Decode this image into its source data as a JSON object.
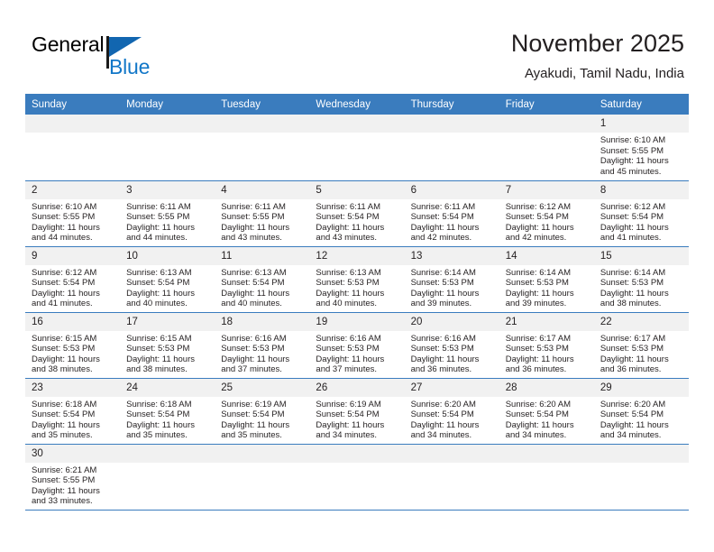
{
  "brand": {
    "name_part1": "General",
    "name_part2": "Blue",
    "flag_icon": "brand-flag-icon",
    "accent_color": "#1277c8"
  },
  "header": {
    "title": "November 2025",
    "subtitle": "Ayakudi, Tamil Nadu, India"
  },
  "colors": {
    "header_row_bg": "#3a7cbe",
    "header_row_text": "#ffffff",
    "daynum_bg": "#f1f1f1",
    "cell_border": "#3a7cbe",
    "text": "#231f20"
  },
  "weekday_headers": [
    "Sunday",
    "Monday",
    "Tuesday",
    "Wednesday",
    "Thursday",
    "Friday",
    "Saturday"
  ],
  "weeks": [
    [
      {
        "blank": true
      },
      {
        "blank": true
      },
      {
        "blank": true
      },
      {
        "blank": true
      },
      {
        "blank": true
      },
      {
        "blank": true
      },
      {
        "day": "1",
        "sunrise": "Sunrise: 6:10 AM",
        "sunset": "Sunset: 5:55 PM",
        "daylight1": "Daylight: 11 hours",
        "daylight2": "and 45 minutes."
      }
    ],
    [
      {
        "day": "2",
        "sunrise": "Sunrise: 6:10 AM",
        "sunset": "Sunset: 5:55 PM",
        "daylight1": "Daylight: 11 hours",
        "daylight2": "and 44 minutes."
      },
      {
        "day": "3",
        "sunrise": "Sunrise: 6:11 AM",
        "sunset": "Sunset: 5:55 PM",
        "daylight1": "Daylight: 11 hours",
        "daylight2": "and 44 minutes."
      },
      {
        "day": "4",
        "sunrise": "Sunrise: 6:11 AM",
        "sunset": "Sunset: 5:55 PM",
        "daylight1": "Daylight: 11 hours",
        "daylight2": "and 43 minutes."
      },
      {
        "day": "5",
        "sunrise": "Sunrise: 6:11 AM",
        "sunset": "Sunset: 5:54 PM",
        "daylight1": "Daylight: 11 hours",
        "daylight2": "and 43 minutes."
      },
      {
        "day": "6",
        "sunrise": "Sunrise: 6:11 AM",
        "sunset": "Sunset: 5:54 PM",
        "daylight1": "Daylight: 11 hours",
        "daylight2": "and 42 minutes."
      },
      {
        "day": "7",
        "sunrise": "Sunrise: 6:12 AM",
        "sunset": "Sunset: 5:54 PM",
        "daylight1": "Daylight: 11 hours",
        "daylight2": "and 42 minutes."
      },
      {
        "day": "8",
        "sunrise": "Sunrise: 6:12 AM",
        "sunset": "Sunset: 5:54 PM",
        "daylight1": "Daylight: 11 hours",
        "daylight2": "and 41 minutes."
      }
    ],
    [
      {
        "day": "9",
        "sunrise": "Sunrise: 6:12 AM",
        "sunset": "Sunset: 5:54 PM",
        "daylight1": "Daylight: 11 hours",
        "daylight2": "and 41 minutes."
      },
      {
        "day": "10",
        "sunrise": "Sunrise: 6:13 AM",
        "sunset": "Sunset: 5:54 PM",
        "daylight1": "Daylight: 11 hours",
        "daylight2": "and 40 minutes."
      },
      {
        "day": "11",
        "sunrise": "Sunrise: 6:13 AM",
        "sunset": "Sunset: 5:54 PM",
        "daylight1": "Daylight: 11 hours",
        "daylight2": "and 40 minutes."
      },
      {
        "day": "12",
        "sunrise": "Sunrise: 6:13 AM",
        "sunset": "Sunset: 5:53 PM",
        "daylight1": "Daylight: 11 hours",
        "daylight2": "and 40 minutes."
      },
      {
        "day": "13",
        "sunrise": "Sunrise: 6:14 AM",
        "sunset": "Sunset: 5:53 PM",
        "daylight1": "Daylight: 11 hours",
        "daylight2": "and 39 minutes."
      },
      {
        "day": "14",
        "sunrise": "Sunrise: 6:14 AM",
        "sunset": "Sunset: 5:53 PM",
        "daylight1": "Daylight: 11 hours",
        "daylight2": "and 39 minutes."
      },
      {
        "day": "15",
        "sunrise": "Sunrise: 6:14 AM",
        "sunset": "Sunset: 5:53 PM",
        "daylight1": "Daylight: 11 hours",
        "daylight2": "and 38 minutes."
      }
    ],
    [
      {
        "day": "16",
        "sunrise": "Sunrise: 6:15 AM",
        "sunset": "Sunset: 5:53 PM",
        "daylight1": "Daylight: 11 hours",
        "daylight2": "and 38 minutes."
      },
      {
        "day": "17",
        "sunrise": "Sunrise: 6:15 AM",
        "sunset": "Sunset: 5:53 PM",
        "daylight1": "Daylight: 11 hours",
        "daylight2": "and 38 minutes."
      },
      {
        "day": "18",
        "sunrise": "Sunrise: 6:16 AM",
        "sunset": "Sunset: 5:53 PM",
        "daylight1": "Daylight: 11 hours",
        "daylight2": "and 37 minutes."
      },
      {
        "day": "19",
        "sunrise": "Sunrise: 6:16 AM",
        "sunset": "Sunset: 5:53 PM",
        "daylight1": "Daylight: 11 hours",
        "daylight2": "and 37 minutes."
      },
      {
        "day": "20",
        "sunrise": "Sunrise: 6:16 AM",
        "sunset": "Sunset: 5:53 PM",
        "daylight1": "Daylight: 11 hours",
        "daylight2": "and 36 minutes."
      },
      {
        "day": "21",
        "sunrise": "Sunrise: 6:17 AM",
        "sunset": "Sunset: 5:53 PM",
        "daylight1": "Daylight: 11 hours",
        "daylight2": "and 36 minutes."
      },
      {
        "day": "22",
        "sunrise": "Sunrise: 6:17 AM",
        "sunset": "Sunset: 5:53 PM",
        "daylight1": "Daylight: 11 hours",
        "daylight2": "and 36 minutes."
      }
    ],
    [
      {
        "day": "23",
        "sunrise": "Sunrise: 6:18 AM",
        "sunset": "Sunset: 5:54 PM",
        "daylight1": "Daylight: 11 hours",
        "daylight2": "and 35 minutes."
      },
      {
        "day": "24",
        "sunrise": "Sunrise: 6:18 AM",
        "sunset": "Sunset: 5:54 PM",
        "daylight1": "Daylight: 11 hours",
        "daylight2": "and 35 minutes."
      },
      {
        "day": "25",
        "sunrise": "Sunrise: 6:19 AM",
        "sunset": "Sunset: 5:54 PM",
        "daylight1": "Daylight: 11 hours",
        "daylight2": "and 35 minutes."
      },
      {
        "day": "26",
        "sunrise": "Sunrise: 6:19 AM",
        "sunset": "Sunset: 5:54 PM",
        "daylight1": "Daylight: 11 hours",
        "daylight2": "and 34 minutes."
      },
      {
        "day": "27",
        "sunrise": "Sunrise: 6:20 AM",
        "sunset": "Sunset: 5:54 PM",
        "daylight1": "Daylight: 11 hours",
        "daylight2": "and 34 minutes."
      },
      {
        "day": "28",
        "sunrise": "Sunrise: 6:20 AM",
        "sunset": "Sunset: 5:54 PM",
        "daylight1": "Daylight: 11 hours",
        "daylight2": "and 34 minutes."
      },
      {
        "day": "29",
        "sunrise": "Sunrise: 6:20 AM",
        "sunset": "Sunset: 5:54 PM",
        "daylight1": "Daylight: 11 hours",
        "daylight2": "and 34 minutes."
      }
    ],
    [
      {
        "day": "30",
        "sunrise": "Sunrise: 6:21 AM",
        "sunset": "Sunset: 5:55 PM",
        "daylight1": "Daylight: 11 hours",
        "daylight2": "and 33 minutes."
      },
      {
        "blank": true
      },
      {
        "blank": true
      },
      {
        "blank": true
      },
      {
        "blank": true
      },
      {
        "blank": true
      },
      {
        "blank": true
      }
    ]
  ]
}
